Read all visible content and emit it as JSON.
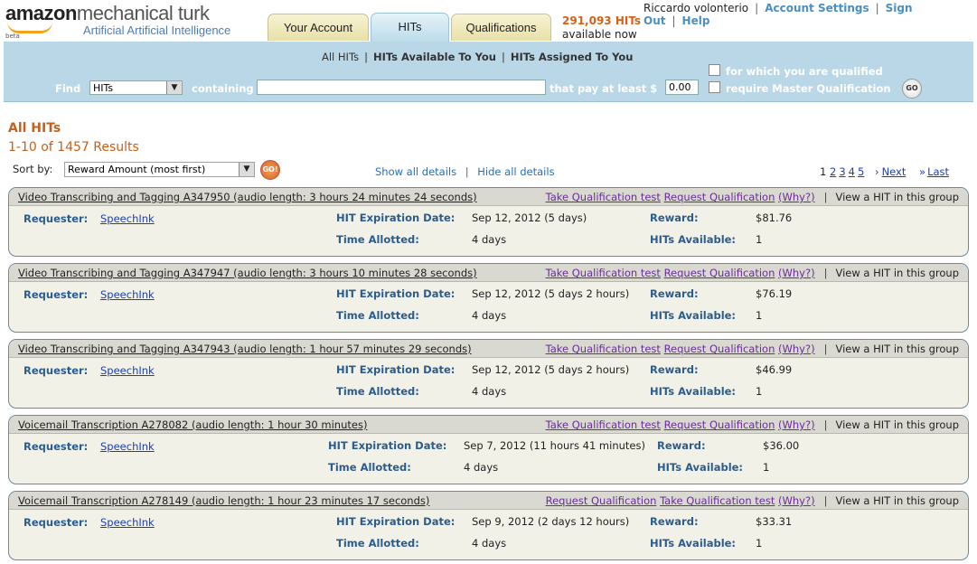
{
  "header": {
    "logo_word1": "amazon",
    "logo_word2": "mechanical turk",
    "logo_tagline": "Artificial Artificial Intelligence",
    "logo_beta": "beta",
    "tabs": [
      {
        "label": "Your Account"
      },
      {
        "label": "HITs"
      },
      {
        "label": "Qualifications"
      }
    ],
    "hit_count": "291,093 HITs",
    "hit_count_sub": "available now",
    "user_name": "Riccardo volonterio",
    "links": {
      "account_settings": "Account Settings",
      "sign_out": "Sign Out",
      "help": "Help"
    }
  },
  "search": {
    "subnav": {
      "all": "All HITs",
      "available": "HITs Available To You",
      "assigned": "HITs Assigned To You"
    },
    "find_label": "Find",
    "find_select": "HITs",
    "containing_label": "containing",
    "containing_value": "",
    "pay_label": "that pay at least $",
    "pay_value": "0.00",
    "qualified_label": "for which you are qualified",
    "master_label": "require Master Qualification",
    "go_label": "GO"
  },
  "results": {
    "title": "All HITs",
    "count": "1-10 of 1457 Results",
    "sort_label": "Sort by:",
    "sort_value": "Reward Amount (most first)",
    "go_label": "GO!",
    "show_all": "Show all details",
    "hide_all": "Hide all details",
    "pages": [
      "1",
      "2",
      "3",
      "4",
      "5"
    ],
    "next": "Next",
    "last": "Last"
  },
  "labels": {
    "requester": "Requester:",
    "expiration": "HIT Expiration Date:",
    "time_allotted": "Time Allotted:",
    "reward": "Reward:",
    "hits_available": "HITs Available:",
    "take_qual": "Take Qualification test",
    "request_qual": "Request Qualification",
    "why": "(Why?)",
    "view_hit": "View a HIT in this group"
  },
  "hits": [
    {
      "title": "Video Transcribing and Tagging A347950 (audio length: 3 hours 24 minutes 24 seconds)",
      "requester": "SpeechInk",
      "expiration": "Sep 12, 2012  (5 days)",
      "time_allotted": "4 days",
      "reward": "$81.76",
      "available": "1"
    },
    {
      "title": "Video Transcribing and Tagging A347947 (audio length: 3 hours 10 minutes 28 seconds)",
      "requester": "SpeechInk",
      "expiration": "Sep 12, 2012  (5 days 2 hours)",
      "time_allotted": "4 days",
      "reward": "$76.19",
      "available": "1"
    },
    {
      "title": "Video Transcribing and Tagging A347943 (audio length: 1 hour 57 minutes 29 seconds)",
      "requester": "SpeechInk",
      "expiration": "Sep 12, 2012  (5 days 2 hours)",
      "time_allotted": "4 days",
      "reward": "$46.99",
      "available": "1"
    },
    {
      "title": "Voicemail Transcription A278082 (audio length: 1 hour 30 minutes)",
      "requester": "SpeechInk",
      "expiration": "Sep 7, 2012  (11 hours 41 minutes)",
      "time_allotted": "4 days",
      "reward": "$36.00",
      "available": "1"
    },
    {
      "title": "Voicemail Transcription A278149 (audio length: 1 hour 23 minutes 17 seconds)",
      "requester": "SpeechInk",
      "expiration": "Sep 9, 2012  (2 days 12 hours)",
      "time_allotted": "4 days",
      "reward": "$33.31",
      "available": "1"
    }
  ]
}
